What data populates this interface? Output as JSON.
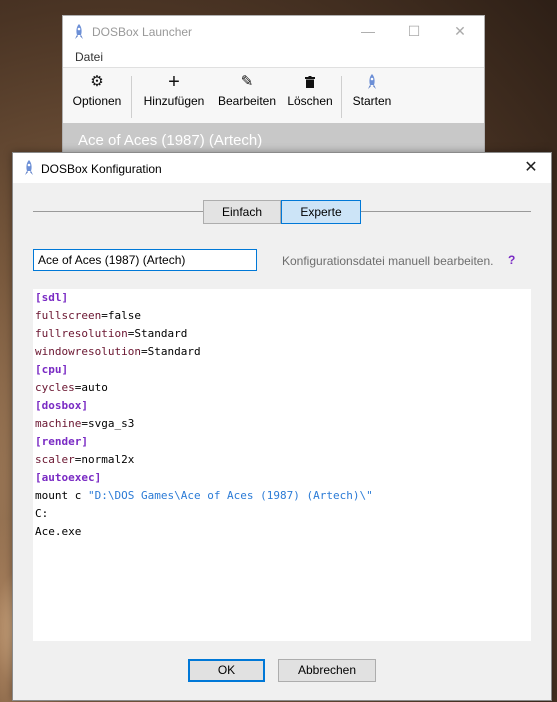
{
  "launcher": {
    "title": "DOSBox Launcher",
    "menu": {
      "datei": "Datei"
    },
    "toolbar": {
      "optionen": "Optionen",
      "hinzufuegen": "Hinzufügen",
      "bearbeiten": "Bearbeiten",
      "loeschen": "Löschen",
      "starten": "Starten"
    },
    "selected_game": "Ace of Aces (1987) (Artech)"
  },
  "dialog": {
    "title": "DOSBox Konfiguration",
    "tabs": {
      "einfach": "Einfach",
      "experte": "Experte",
      "active": "Experte"
    },
    "name_value": "Ace of Aces (1987) (Artech)",
    "hint": "Konfigurationsdatei manuell bearbeiten.",
    "help": "?",
    "config_lines": [
      {
        "section": "[sdl]"
      },
      {
        "key": "fullscreen",
        "value": "false"
      },
      {
        "key": "fullresolution",
        "value": "Standard"
      },
      {
        "key": "windowresolution",
        "value": "Standard"
      },
      {
        "section": "[cpu]"
      },
      {
        "key": "cycles",
        "value": "auto"
      },
      {
        "section": "[dosbox]"
      },
      {
        "key": "machine",
        "value": "svga_s3"
      },
      {
        "section": "[render]"
      },
      {
        "key": "scaler",
        "value": "normal2x"
      },
      {
        "section": "[autoexec]"
      },
      {
        "plain": "mount c ",
        "string": "\"D:\\DOS Games\\Ace of Aces (1987) (Artech)\\\""
      },
      {
        "plain": "C:"
      },
      {
        "plain": "Ace.exe"
      }
    ],
    "ok": "OK",
    "cancel": "Abbrechen"
  },
  "colors": {
    "section": "#7a2bc4",
    "key": "#6a1530",
    "string": "#2b7bd6",
    "accent": "#0078d7"
  }
}
